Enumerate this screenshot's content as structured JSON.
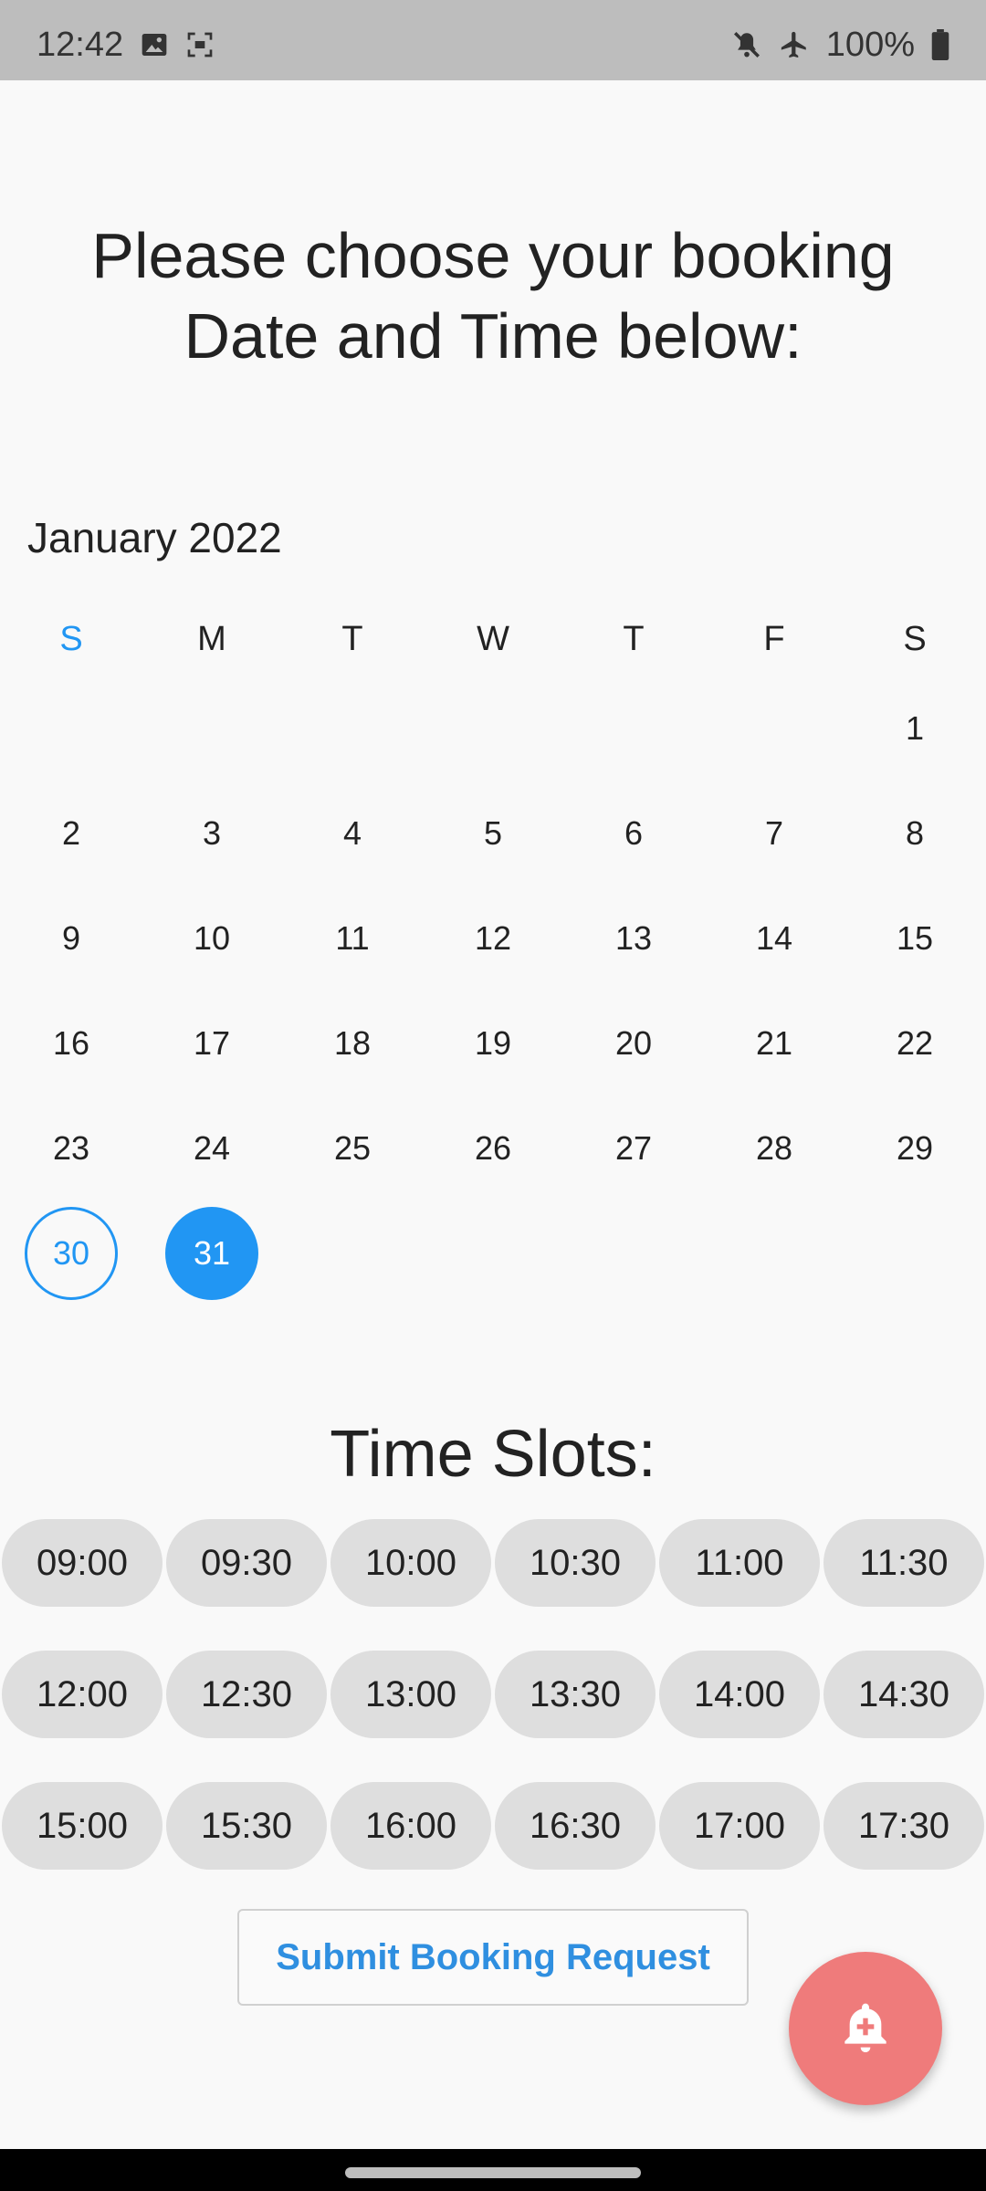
{
  "status_bar": {
    "time": "12:42",
    "battery": "100%",
    "icons": [
      "image-icon",
      "screenshot-icon",
      "mute-icon",
      "airplane-icon",
      "battery-icon"
    ]
  },
  "heading": {
    "line1": "Please choose your booking",
    "line2": "Date and Time below:"
  },
  "calendar": {
    "month": "January 2022",
    "weekdays": [
      "S",
      "M",
      "T",
      "W",
      "T",
      "F",
      "S"
    ],
    "weeks": [
      [
        "",
        "",
        "",
        "",
        "",
        "",
        "1"
      ],
      [
        "2",
        "3",
        "4",
        "5",
        "6",
        "7",
        "8"
      ],
      [
        "9",
        "10",
        "11",
        "12",
        "13",
        "14",
        "15"
      ],
      [
        "16",
        "17",
        "18",
        "19",
        "20",
        "21",
        "22"
      ],
      [
        "23",
        "24",
        "25",
        "26",
        "27",
        "28",
        "29"
      ],
      [
        "30",
        "31",
        "",
        "",
        "",
        "",
        ""
      ]
    ],
    "today": "30",
    "selected": "31",
    "accent_color": "#2196f3"
  },
  "time_slots": {
    "title": "Time Slots:",
    "slots": [
      "09:00",
      "09:30",
      "10:00",
      "10:30",
      "11:00",
      "11:30",
      "12:00",
      "12:30",
      "13:00",
      "13:30",
      "14:00",
      "14:30",
      "15:00",
      "15:30",
      "16:00",
      "16:30",
      "17:00",
      "17:30"
    ]
  },
  "submit_label": "Submit Booking Request",
  "fab": {
    "icon": "add-alert-icon",
    "color": "#ef7b7b"
  }
}
